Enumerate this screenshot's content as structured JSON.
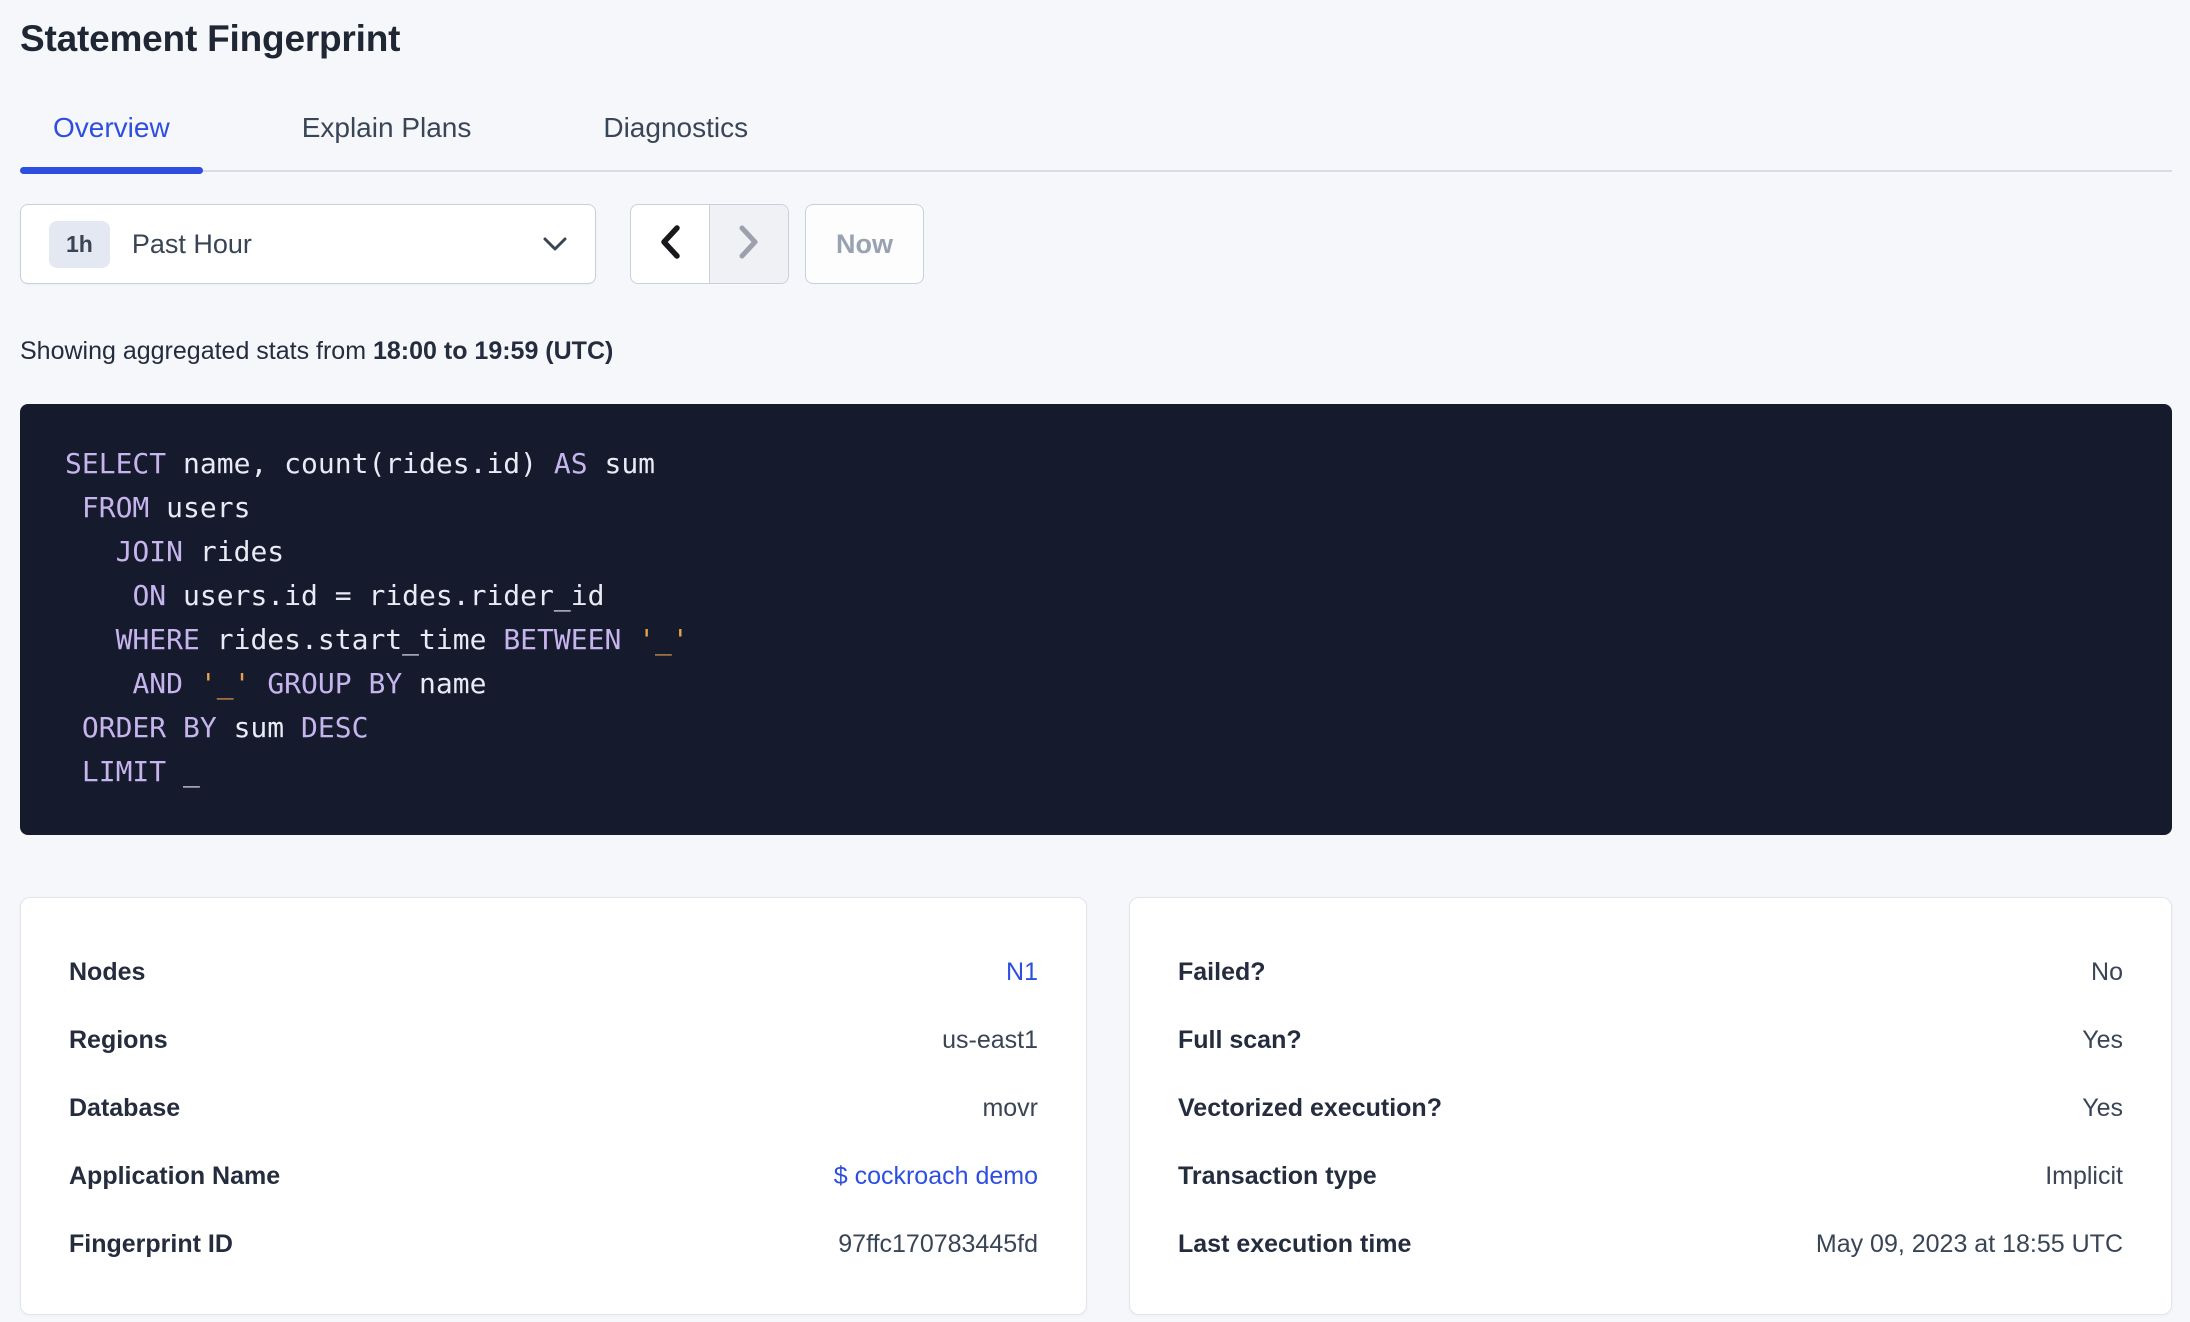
{
  "header": {
    "title": "Statement Fingerprint"
  },
  "tabs": [
    {
      "label": "Overview",
      "active": true
    },
    {
      "label": "Explain Plans",
      "active": false
    },
    {
      "label": "Diagnostics",
      "active": false
    }
  ],
  "time_selector": {
    "badge": "1h",
    "label": "Past Hour",
    "now_label": "Now",
    "prev_enabled": true,
    "next_enabled": false
  },
  "caption": {
    "prefix": "Showing aggregated stats from ",
    "range": "18:00 to 19:59 (UTC)"
  },
  "sql": {
    "lines": [
      {
        "tokens": [
          {
            "text": "SELECT",
            "type": "keyword"
          },
          {
            "text": " name, count(rides.id) ",
            "type": "plain"
          },
          {
            "text": "AS",
            "type": "keyword"
          },
          {
            "text": " sum",
            "type": "plain"
          }
        ]
      },
      {
        "tokens": [
          {
            "text": " ",
            "type": "plain"
          },
          {
            "text": "FROM",
            "type": "keyword"
          },
          {
            "text": " users",
            "type": "plain"
          }
        ]
      },
      {
        "tokens": [
          {
            "text": "   ",
            "type": "plain"
          },
          {
            "text": "JOIN",
            "type": "keyword"
          },
          {
            "text": " rides",
            "type": "plain"
          }
        ]
      },
      {
        "tokens": [
          {
            "text": "    ",
            "type": "plain"
          },
          {
            "text": "ON",
            "type": "keyword"
          },
          {
            "text": " users.id = rides.rider_id",
            "type": "plain"
          }
        ]
      },
      {
        "tokens": [
          {
            "text": "   ",
            "type": "plain"
          },
          {
            "text": "WHERE",
            "type": "keyword"
          },
          {
            "text": " rides.start_time ",
            "type": "plain"
          },
          {
            "text": "BETWEEN",
            "type": "keyword"
          },
          {
            "text": " ",
            "type": "plain"
          },
          {
            "text": "'_'",
            "type": "string"
          }
        ]
      },
      {
        "tokens": [
          {
            "text": "    ",
            "type": "plain"
          },
          {
            "text": "AND",
            "type": "keyword"
          },
          {
            "text": " ",
            "type": "plain"
          },
          {
            "text": "'_'",
            "type": "string"
          },
          {
            "text": " ",
            "type": "plain"
          },
          {
            "text": "GROUP BY",
            "type": "keyword"
          },
          {
            "text": " name",
            "type": "plain"
          }
        ]
      },
      {
        "tokens": [
          {
            "text": " ",
            "type": "plain"
          },
          {
            "text": "ORDER BY",
            "type": "keyword"
          },
          {
            "text": " sum ",
            "type": "plain"
          },
          {
            "text": "DESC",
            "type": "keyword"
          }
        ]
      },
      {
        "tokens": [
          {
            "text": " ",
            "type": "plain"
          },
          {
            "text": "LIMIT",
            "type": "keyword"
          },
          {
            "text": " _",
            "type": "plain"
          }
        ]
      }
    ]
  },
  "cards": {
    "left": {
      "rows": [
        {
          "label": "Nodes",
          "value": "N1",
          "link": true
        },
        {
          "label": "Regions",
          "value": "us-east1",
          "link": false
        },
        {
          "label": "Database",
          "value": "movr",
          "link": false
        },
        {
          "label": "Application Name",
          "value": "$ cockroach demo",
          "link": true
        },
        {
          "label": "Fingerprint ID",
          "value": "97ffc170783445fd",
          "link": false
        }
      ]
    },
    "right": {
      "rows": [
        {
          "label": "Failed?",
          "value": "No",
          "link": false
        },
        {
          "label": "Full scan?",
          "value": "Yes",
          "link": false
        },
        {
          "label": "Vectorized execution?",
          "value": "Yes",
          "link": false
        },
        {
          "label": "Transaction type",
          "value": "Implicit",
          "link": false
        },
        {
          "label": "Last execution time",
          "value": "May 09, 2023 at 18:55 UTC",
          "link": false
        }
      ]
    }
  },
  "colors": {
    "accent": "#2D4EE0",
    "page_background": "#F5F7FA",
    "code_background": "#151A2D",
    "code_keyword": "#C6B4ED",
    "code_string": "#E8A14E",
    "code_plain": "#E8EAF4"
  }
}
